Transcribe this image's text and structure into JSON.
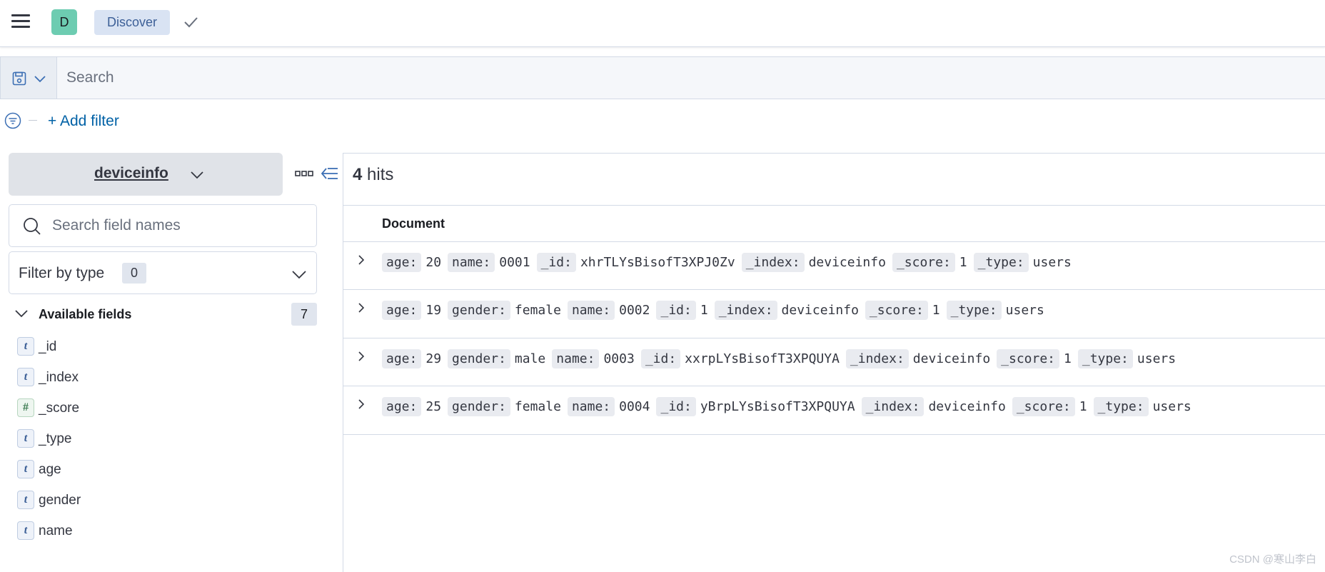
{
  "header": {
    "space_initial": "D",
    "breadcrumb": "Discover"
  },
  "query": {
    "placeholder": "Search"
  },
  "filters": {
    "add_filter_label": "+ Add filter"
  },
  "sidebar": {
    "index_pattern": "deviceinfo",
    "field_search_placeholder": "Search field names",
    "filter_by_type_label": "Filter by type",
    "filter_by_type_count": "0",
    "available_fields_label": "Available fields",
    "available_fields_count": "7",
    "fields": [
      {
        "type": "t",
        "name": "_id"
      },
      {
        "type": "t",
        "name": "_index"
      },
      {
        "type": "#",
        "name": "_score"
      },
      {
        "type": "t",
        "name": "_type"
      },
      {
        "type": "t",
        "name": "age"
      },
      {
        "type": "t",
        "name": "gender"
      },
      {
        "type": "t",
        "name": "name"
      }
    ]
  },
  "results": {
    "hits_count": "4",
    "hits_label": "hits",
    "document_header": "Document",
    "rows": [
      [
        {
          "k": "age:",
          "v": "20"
        },
        {
          "k": "name:",
          "v": "0001"
        },
        {
          "k": "_id:",
          "v": "xhrTLYsBisofT3XPJ0Zv"
        },
        {
          "k": "_index:",
          "v": "deviceinfo"
        },
        {
          "k": "_score:",
          "v": "1"
        },
        {
          "k": "_type:",
          "v": "users"
        }
      ],
      [
        {
          "k": "age:",
          "v": "19"
        },
        {
          "k": "gender:",
          "v": "female"
        },
        {
          "k": "name:",
          "v": "0002"
        },
        {
          "k": "_id:",
          "v": "1"
        },
        {
          "k": "_index:",
          "v": "deviceinfo"
        },
        {
          "k": "_score:",
          "v": "1"
        },
        {
          "k": "_type:",
          "v": "users"
        }
      ],
      [
        {
          "k": "age:",
          "v": "29"
        },
        {
          "k": "gender:",
          "v": "male"
        },
        {
          "k": "name:",
          "v": "0003"
        },
        {
          "k": "_id:",
          "v": "xxrpLYsBisofT3XPQUYA"
        },
        {
          "k": "_index:",
          "v": "deviceinfo"
        },
        {
          "k": "_score:",
          "v": "1"
        },
        {
          "k": "_type:",
          "v": "users"
        }
      ],
      [
        {
          "k": "age:",
          "v": "25"
        },
        {
          "k": "gender:",
          "v": "female"
        },
        {
          "k": "name:",
          "v": "0004"
        },
        {
          "k": "_id:",
          "v": "yBrpLYsBisofT3XPQUYA"
        },
        {
          "k": "_index:",
          "v": "deviceinfo"
        },
        {
          "k": "_score:",
          "v": "1"
        },
        {
          "k": "_type:",
          "v": "users"
        }
      ]
    ]
  },
  "watermark": "CSDN @寒山李白",
  "colors": {
    "accent_link": "#0061a6",
    "breadcrumb_bg": "#d9e3f3",
    "avatar_bg": "#6dccb1",
    "border": "#d3dae6"
  }
}
